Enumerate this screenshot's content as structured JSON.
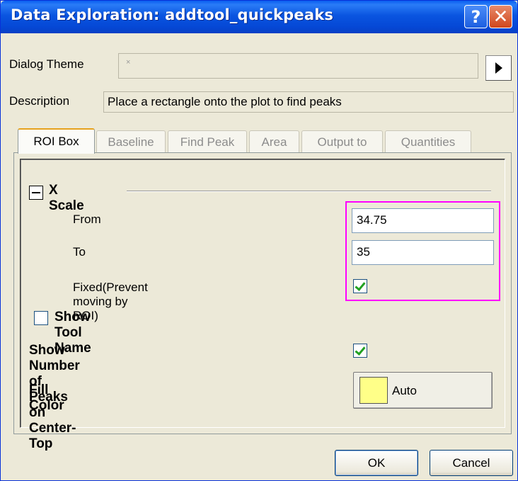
{
  "window": {
    "title": "Data Exploration: addtool_quickpeaks",
    "help_glyph": "?",
    "close_glyph": "✕"
  },
  "dialog_theme": {
    "label": "Dialog Theme",
    "value": "×"
  },
  "description": {
    "label": "Description",
    "value": "Place a rectangle onto the plot to find peaks"
  },
  "tabs": [
    {
      "label": "ROI Box",
      "active": true
    },
    {
      "label": "Baseline",
      "active": false
    },
    {
      "label": "Find Peak",
      "active": false
    },
    {
      "label": "Area",
      "active": false
    },
    {
      "label": "Output to",
      "active": false
    },
    {
      "label": "Quantities",
      "active": false
    }
  ],
  "x_scale": {
    "title": "X Scale",
    "from_label": "From",
    "from_value": "34.75",
    "to_label": "To",
    "to_value": "35",
    "fixed_label": "Fixed(Prevent moving by ROI)",
    "fixed_checked": true
  },
  "show_tool_name": {
    "label": "Show Tool Name",
    "checked": false
  },
  "show_number_peaks": {
    "label": "Show Number of Peaks on Center-Top",
    "checked": true
  },
  "fill_color": {
    "label": "Fill Color",
    "value": "Auto",
    "swatch": "#ffff88"
  },
  "buttons": {
    "ok": "OK",
    "cancel": "Cancel"
  },
  "colors": {
    "titlebar": "#0548d6",
    "highlight": "#ff00ff",
    "dialog_bg": "#ECE9D8"
  }
}
